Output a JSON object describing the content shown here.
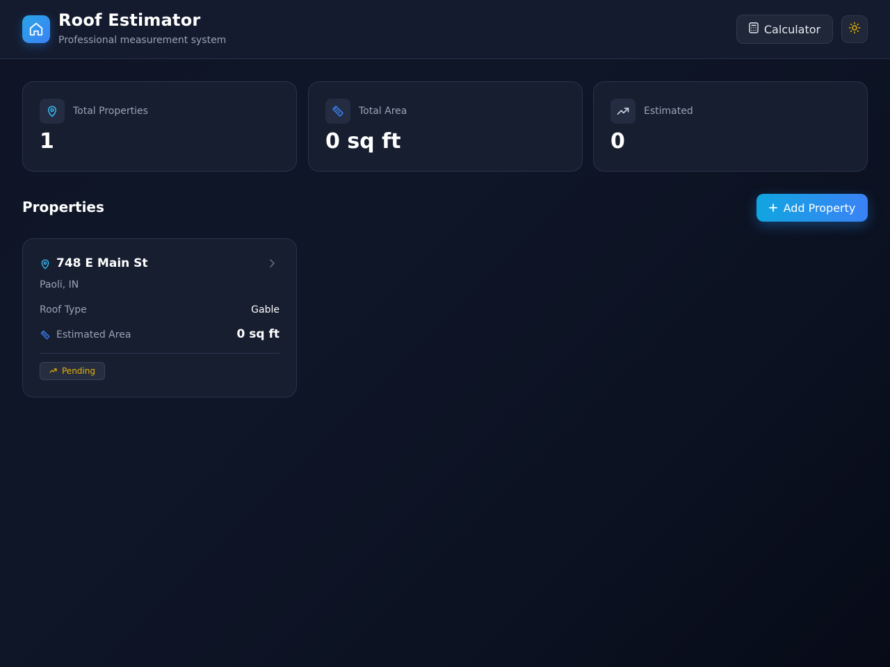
{
  "header": {
    "title": "Roof Estimator",
    "subtitle": "Professional measurement system",
    "calculator_label": "Calculator",
    "logo_icon": "home-icon",
    "theme_icon": "sun-icon"
  },
  "stats": [
    {
      "label": "Total Properties",
      "value": "1",
      "icon": "map-pin-icon"
    },
    {
      "label": "Total Area",
      "value": "0 sq ft",
      "icon": "ruler-icon"
    },
    {
      "label": "Estimated",
      "value": "0",
      "icon": "trending-up-icon"
    }
  ],
  "properties_section": {
    "title": "Properties",
    "add_label": "Add Property"
  },
  "properties": [
    {
      "address": "748 E Main St",
      "city": "Paoli, IN",
      "roof_type_label": "Roof Type",
      "roof_type": "Gable",
      "area_label": "Estimated Area",
      "area": "0 sq ft",
      "status": "Pending"
    }
  ],
  "colors": {
    "accent": "#3b82f6",
    "accent_cyan": "#10a5e0",
    "pending": "#eab308",
    "background": "#0f1526",
    "card": "#171e30"
  }
}
